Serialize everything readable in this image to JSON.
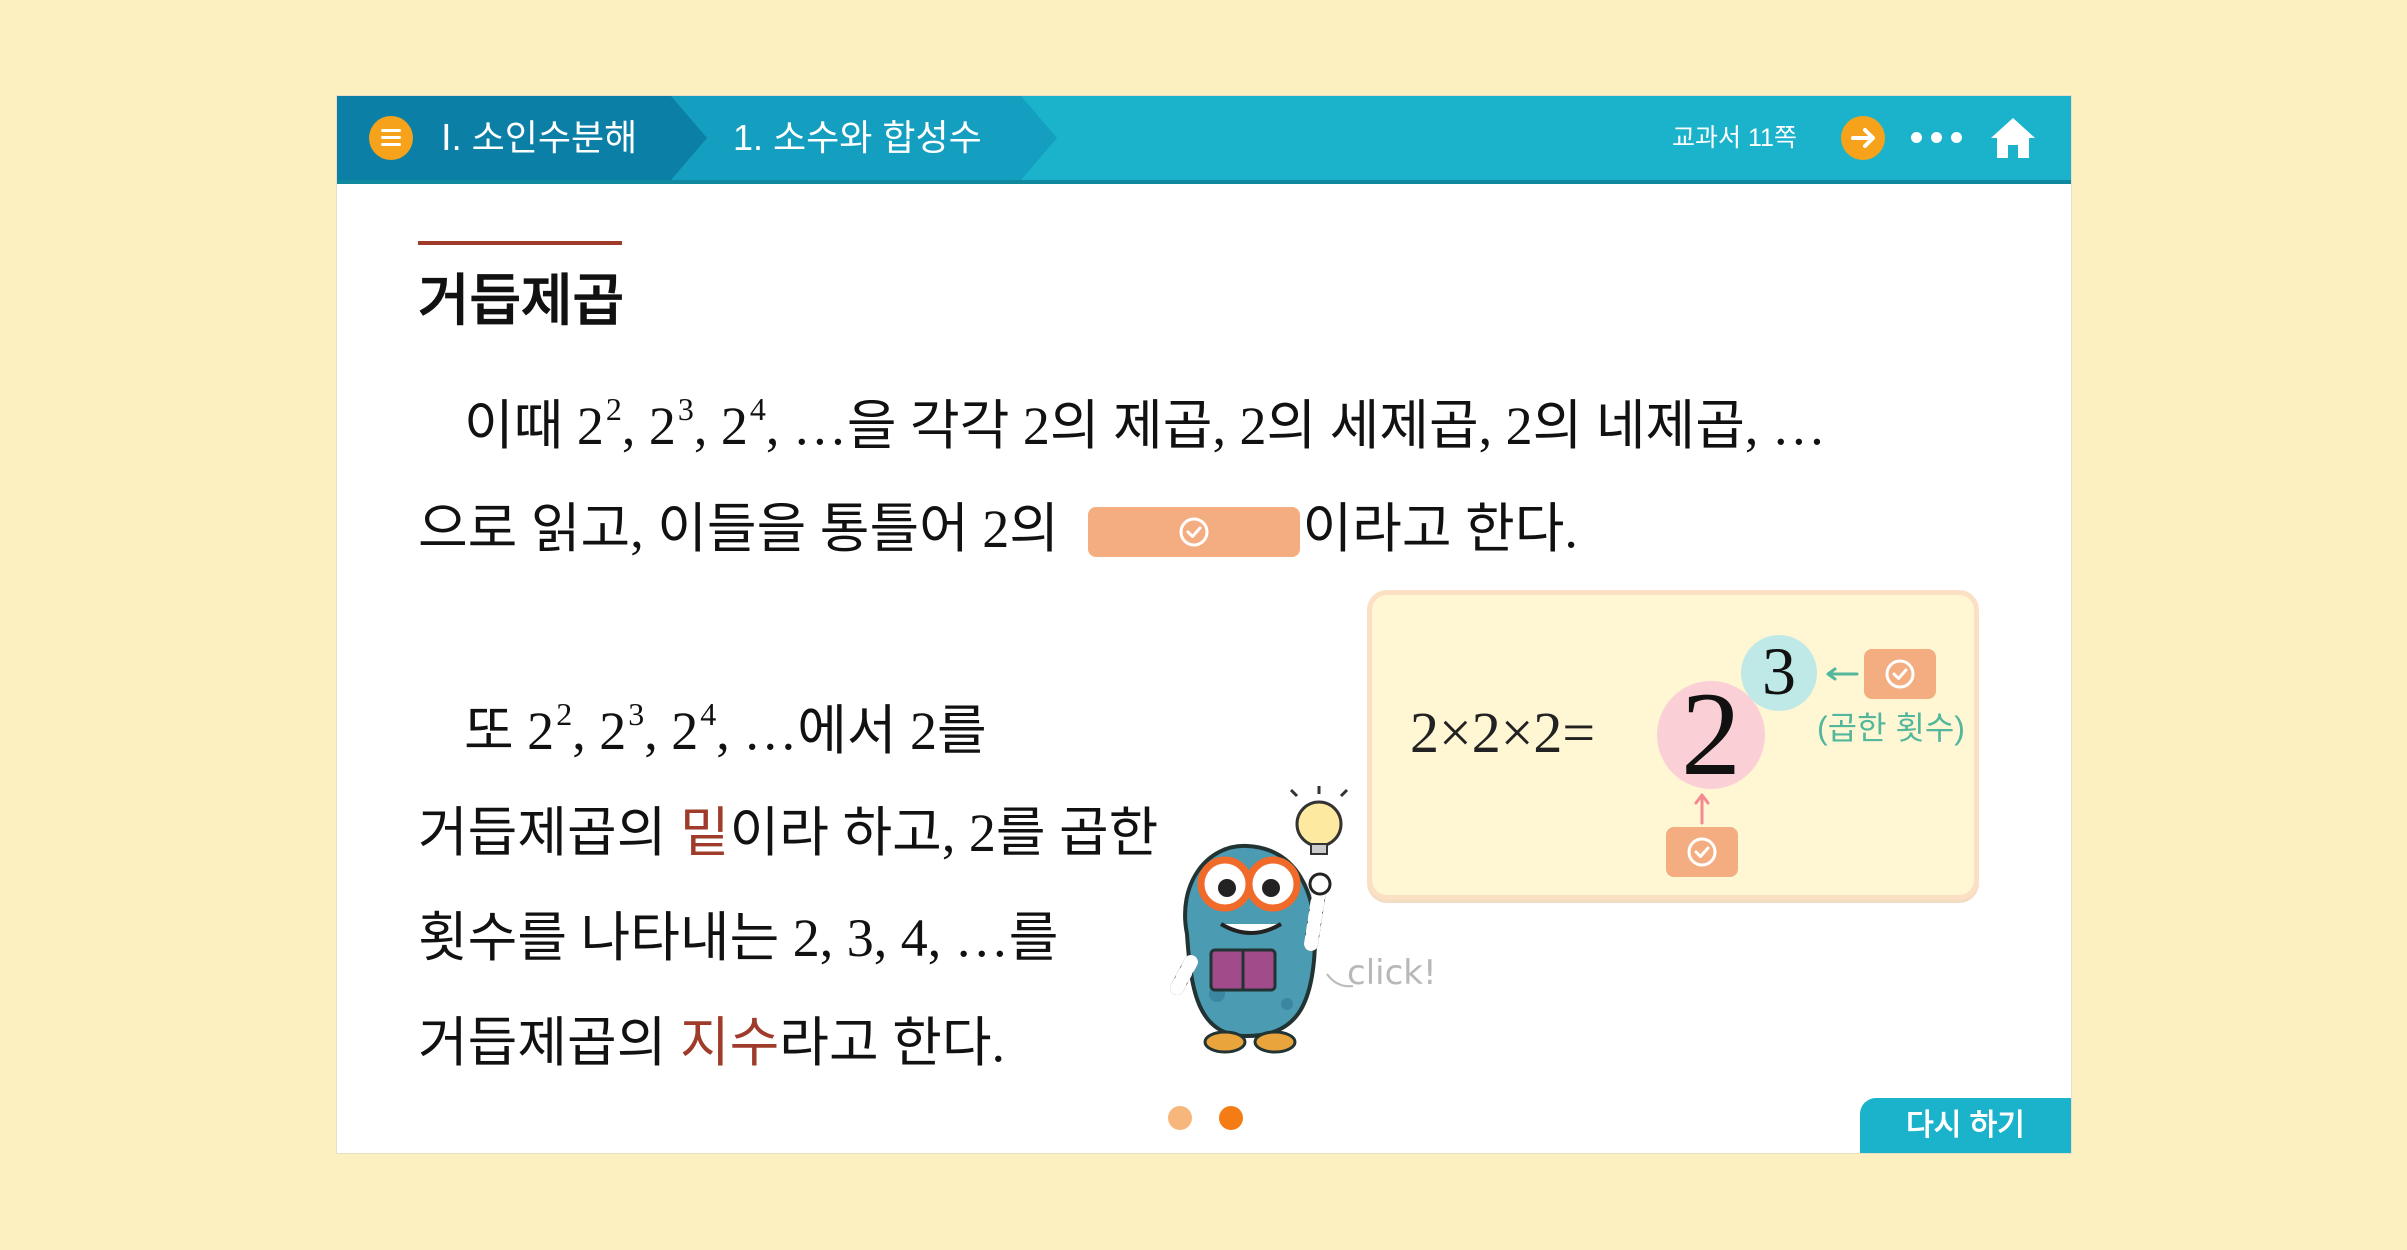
{
  "header": {
    "unit": "Ⅰ. 소인수분해",
    "section": "1. 소수와 합성수",
    "textbook_ref": "교과서 11쪽",
    "icons": {
      "menu": "menu-icon",
      "next": "arrow-right-icon",
      "more": "more-dots-icon",
      "home": "home-icon"
    }
  },
  "content": {
    "title": "거듭제곱",
    "p1_intro": "이때 2",
    "p1_sup1": "2",
    "p1_sep1": ", 2",
    "p1_sup2": "3",
    "p1_sep2": ", 2",
    "p1_sup3": "4",
    "p1_rest": ", …을 각각 2의 제곱, 2의 세제곱, 2의 네제곱, …",
    "p2_before": "으로 읽고, 이들을 통틀어 2의 ",
    "p2_after": "이라고 한다.",
    "p3_intro": "또 2",
    "p3_sup1": "2",
    "p3_sep1": ", 2",
    "p3_sup2": "3",
    "p3_sep2": ", 2",
    "p3_sup3": "4",
    "p3_rest": ", …에서 2를",
    "p4_before": "거듭제곱의 ",
    "p4_term": "밑",
    "p4_after": "이라 하고, 2를 곱한",
    "p5": "횟수를 나타내는 2, 3, 4, …를",
    "p6_before": "거듭제곱의 ",
    "p6_term": "지수",
    "p6_after": "라고 한다."
  },
  "diagram": {
    "expression": "2×2×2=",
    "base": "2",
    "exponent": "3",
    "exponent_label": "(곱한 횟수)"
  },
  "mascot": {
    "hint": "click!"
  },
  "footer": {
    "pages": 2,
    "current_page": 2,
    "retry_label": "다시 하기"
  },
  "colors": {
    "background": "#fdf0c0",
    "header": "#1ab3cb",
    "header_dark": "#0b7fa6",
    "accent_orange": "#f6a21b",
    "answer_blank": "#f3ad80",
    "term_red": "#9e3b2a",
    "label_teal": "#53b79c"
  }
}
